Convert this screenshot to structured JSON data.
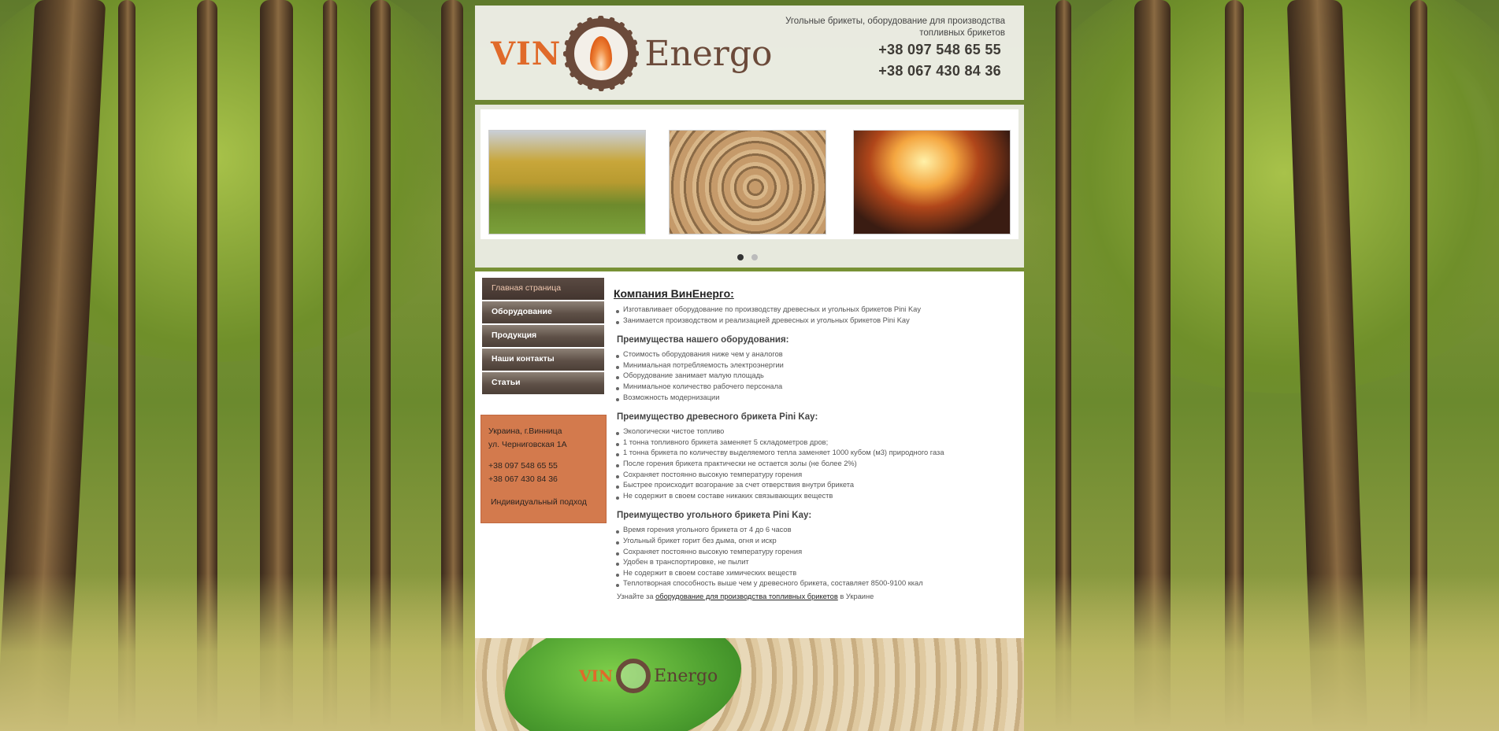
{
  "header": {
    "logo_vin": "VIN",
    "logo_energo": "Energo",
    "tagline": "Угольные брикеты, оборудование для производства топливных брикетов",
    "phone1": "+38 097 548 65 55",
    "phone2": "+38 067 430 84 36"
  },
  "slider": {
    "images": [
      "autumn-tree-photo",
      "stacked-logs-photo",
      "burning-briquettes-photo"
    ],
    "active_dot": 1,
    "dot_count": 2
  },
  "menu": {
    "items": [
      "Главная страница",
      "Оборудование",
      "Продукция",
      "Наши контакты",
      "Статьи"
    ]
  },
  "contact": {
    "city": "Украина, г.Винница",
    "street": "ул. Черниговская 1А",
    "phone1": "+38 097 548 65 55",
    "phone2": "+38 067 430 84 36",
    "approach": "Индивидуальный подход"
  },
  "article": {
    "title": "Компания ВинЕнерго:",
    "intro": [
      "Изготавливает оборудование по производству древесных и угольных брикетов Pini Kay",
      "Занимается производством и реализацией древесных и угольных брикетов Pini Kay"
    ],
    "sec1_title": "Преимущества нашего оборудования:",
    "sec1": [
      "Стоимость оборудования ниже чем у аналогов",
      "Минимальная потребляемость электроэнергии",
      "Оборудование занимает малую площадь",
      "Минимальное количество рабочего персонала",
      "Возможность модернизации"
    ],
    "sec2_title": "Преимущество древесного брикета Pini Kay:",
    "sec2": [
      "Экологически чистое топливо",
      "1 тонна топливного брикета заменяет 5 складометров дров;",
      "1 тонна брикета по количеству выделяемого тепла заменяет 1000 кубом (м3) природного газа",
      "После горения брикета практически не остается золы (не более 2%)",
      "Сохраняет постоянно высокую температуру горения",
      "Быстрее происходит возгорание за счет отверствия внутри брикета",
      "Не содержит в своем составе никаких связывающих веществ"
    ],
    "sec3_title": "Преимущество угольного брикета Pini Kay:",
    "sec3": [
      "Время горения угольного брикета от 4 до 6 часов",
      "Угольный брикет горит без дыма, огня и искр",
      "Сохраняет постоянно высокую температуру горения",
      "Удобен в транспортировке, не пылит",
      "Не содержит в своем составе химических веществ",
      "Теплотворная способность выше чем у древесного брикета,  составляет 8500-9100 ккал"
    ],
    "more_prefix": "Узнайте за",
    "more_link": "оборудование для производства топливных брикетов",
    "more_suffix": "в Украине"
  },
  "footer": {
    "logo_vin": "VIN",
    "logo_energo": "Energo"
  },
  "colors": {
    "accent": "#e06a2a",
    "brand_brown": "#6b4a3a",
    "contact_box": "#d37a4d",
    "menu_dark": "#4c3f37"
  }
}
